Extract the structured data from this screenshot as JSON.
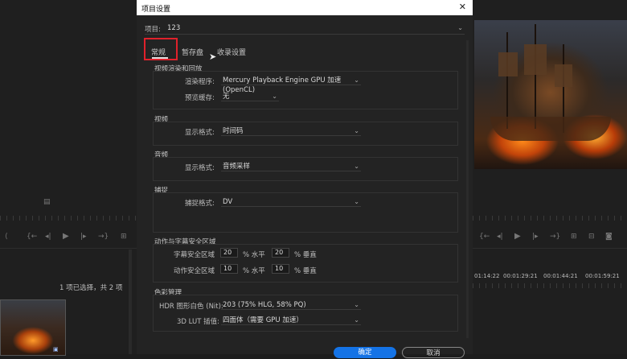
{
  "dialog": {
    "title": "项目设置",
    "close": "✕",
    "project_label": "项目:",
    "project_name": "123",
    "tabs": [
      "常规",
      "暂存盘",
      "收录设置"
    ],
    "sections": {
      "video_render": {
        "heading": "视频渲染和回放",
        "renderer_label": "渲染程序:",
        "renderer_value": "Mercury Playback Engine GPU 加速 (OpenCL)",
        "preview_cache_label": "预览缓存:",
        "preview_cache_value": "无"
      },
      "video": {
        "heading": "视频",
        "format_label": "显示格式:",
        "format_value": "时间码"
      },
      "audio": {
        "heading": "音频",
        "format_label": "显示格式:",
        "format_value": "音频采样"
      },
      "capture": {
        "heading": "捕捉",
        "format_label": "捕捉格式:",
        "format_value": "DV"
      },
      "safe_margins": {
        "heading": "动作与字幕安全区域",
        "title_safe_label": "字幕安全区域",
        "title_h": "20",
        "title_v": "20",
        "action_safe_label": "动作安全区域",
        "action_h": "10",
        "action_v": "10",
        "h_unit": "% 水平",
        "v_unit": "% 垂直"
      },
      "color": {
        "heading": "色彩管理",
        "hdr_label": "HDR 图形白色 (Nit):",
        "hdr_value": "203 (75% HLG, 58% PQ)",
        "lut_label": "3D LUT 插值:",
        "lut_value": "四面体（需要 GPU 加速）"
      }
    },
    "ok_label": "确定",
    "cancel_label": "取消"
  },
  "background": {
    "selection_text": "1 项已选择，共 2 项",
    "timecodes": [
      "01:14:22",
      "00:01:29:21",
      "00:01:44:21",
      "00:01:59:21"
    ]
  },
  "colors": {
    "accent": "#1473e6",
    "highlight": "#e0212b",
    "dialog_bg": "#232323"
  }
}
